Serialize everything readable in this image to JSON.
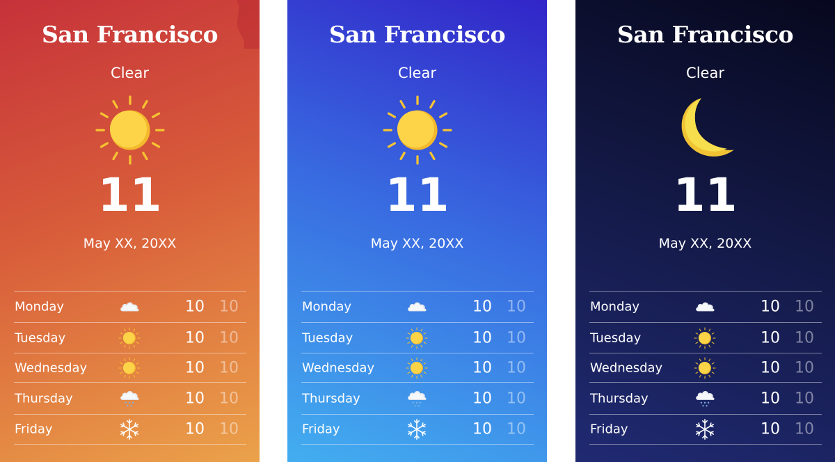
{
  "cards": [
    {
      "theme": "day-warm",
      "colors": {
        "top": "#c6323a",
        "bottom": "#eba24a"
      },
      "city": "San Francisco",
      "condition": "Clear",
      "icon": "sun-icon",
      "temperature": "11",
      "date": "May XX, 20XX",
      "forecast": [
        {
          "day": "Monday",
          "icon": "cloud-icon",
          "high": "10",
          "low": "10"
        },
        {
          "day": "Tuesday",
          "icon": "sun-icon",
          "high": "10",
          "low": "10"
        },
        {
          "day": "Wednesday",
          "icon": "sun-icon",
          "high": "10",
          "low": "10"
        },
        {
          "day": "Thursday",
          "icon": "snow-cloud-icon",
          "high": "10",
          "low": "10"
        },
        {
          "day": "Friday",
          "icon": "snowflake-icon",
          "high": "10",
          "low": "10"
        }
      ]
    },
    {
      "theme": "day-blue",
      "colors": {
        "top": "#3225c8",
        "bottom": "#43aef0"
      },
      "city": "San Francisco",
      "condition": "Clear",
      "icon": "sun-icon",
      "temperature": "11",
      "date": "May XX, 20XX",
      "forecast": [
        {
          "day": "Monday",
          "icon": "cloud-icon",
          "high": "10",
          "low": "10"
        },
        {
          "day": "Tuesday",
          "icon": "sun-icon",
          "high": "10",
          "low": "10"
        },
        {
          "day": "Wednesday",
          "icon": "sun-icon",
          "high": "10",
          "low": "10"
        },
        {
          "day": "Thursday",
          "icon": "snow-cloud-icon",
          "high": "10",
          "low": "10"
        },
        {
          "day": "Friday",
          "icon": "snowflake-icon",
          "high": "10",
          "low": "10"
        }
      ]
    },
    {
      "theme": "night",
      "colors": {
        "top": "#07081e",
        "bottom": "#202a72"
      },
      "city": "San Francisco",
      "condition": "Clear",
      "icon": "moon-icon",
      "temperature": "11",
      "date": "May XX, 20XX",
      "forecast": [
        {
          "day": "Monday",
          "icon": "cloud-icon",
          "high": "10",
          "low": "10"
        },
        {
          "day": "Tuesday",
          "icon": "sun-icon",
          "high": "10",
          "low": "10"
        },
        {
          "day": "Wednesday",
          "icon": "sun-icon",
          "high": "10",
          "low": "10"
        },
        {
          "day": "Thursday",
          "icon": "snow-cloud-icon",
          "high": "10",
          "low": "10"
        },
        {
          "day": "Friday",
          "icon": "snowflake-icon",
          "high": "10",
          "low": "10"
        }
      ]
    }
  ]
}
